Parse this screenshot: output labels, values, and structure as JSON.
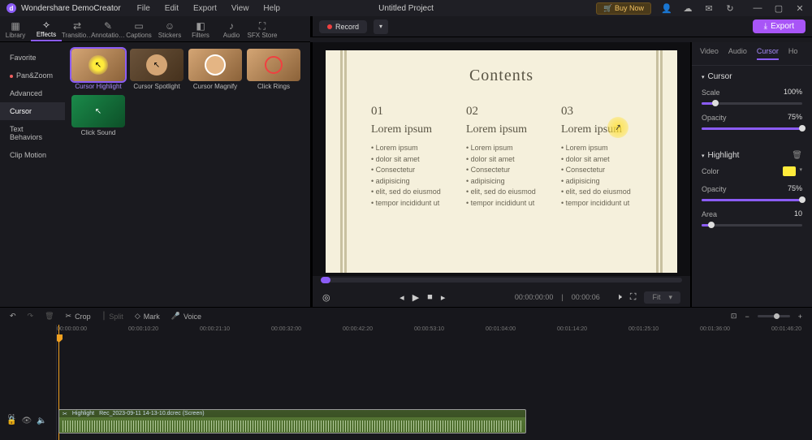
{
  "app": {
    "name": "Wondershare DemoCreator",
    "project": "Untitled Project"
  },
  "menu": [
    "File",
    "Edit",
    "Export",
    "View",
    "Help"
  ],
  "buy": "Buy Now",
  "topTabs": [
    {
      "label": "Library",
      "icon": "▦"
    },
    {
      "label": "Effects",
      "icon": "✧"
    },
    {
      "label": "Transitio…",
      "icon": "⇄"
    },
    {
      "label": "Annotatio…",
      "icon": "✎"
    },
    {
      "label": "Captions",
      "icon": "▭"
    },
    {
      "label": "Stickers",
      "icon": "☺"
    },
    {
      "label": "Filters",
      "icon": "◧"
    },
    {
      "label": "Audio",
      "icon": "♪"
    },
    {
      "label": "SFX Store",
      "icon": "⛶"
    }
  ],
  "leftItems": [
    "Favorite",
    "Pan&Zoom",
    "Advanced",
    "Cursor",
    "Text Behaviors",
    "Clip Motion"
  ],
  "effects": [
    "Cursor Highlight",
    "Cursor Spotlight",
    "Cursor Magnify",
    "Click Rings",
    "Click Sound"
  ],
  "record": "Record",
  "export": "Export",
  "canvas": {
    "title": "Contents",
    "cols": [
      {
        "num": "01",
        "head": "Lorem ipsum"
      },
      {
        "num": "02",
        "head": "Lorem ipsum"
      },
      {
        "num": "03",
        "head": "Lorem ipsum"
      }
    ],
    "bullets": [
      "Lorem ipsum",
      "dolor sit amet",
      "Consectetur",
      "adipisicing",
      "elit, sed do eiusmod",
      "tempor incididunt ut"
    ]
  },
  "timecode": {
    "cur": "00:00:00:00",
    "dur": "00:00:06"
  },
  "fit": "Fit",
  "propTabs": [
    "Video",
    "Audio",
    "Cursor",
    "Ho"
  ],
  "cursor": {
    "heading": "Cursor",
    "scale_label": "Scale",
    "scale_val": "100%",
    "opacity_label": "Opacity",
    "opacity_val": "75%"
  },
  "highlight": {
    "heading": "Highlight",
    "color_label": "Color",
    "opacity_label": "Opacity",
    "opacity_val": "75%",
    "area_label": "Area",
    "area_val": "10"
  },
  "tools": {
    "crop": "Crop",
    "split": "Split",
    "mark": "Mark",
    "voice": "Voice"
  },
  "ruler": [
    "00:00:00:00",
    "00:00:10:20",
    "00:00:21:10",
    "00:00:32:00",
    "00:00:42:20",
    "00:00:53:10",
    "00:01:04:00",
    "00:01:14:20",
    "00:01:25:10",
    "00:01:36:00",
    "00:01:46:20"
  ],
  "clip": {
    "tag": "Highlight",
    "name": "Rec_2023-09-11 14-13-10.dcrec (Screen)"
  },
  "track": "01"
}
